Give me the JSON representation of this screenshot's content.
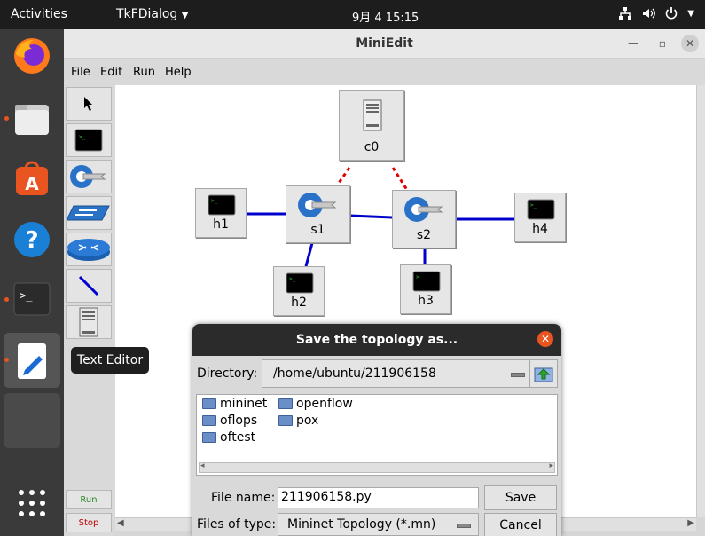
{
  "topbar": {
    "activities": "Activities",
    "app_name": "TkFDialog",
    "clock": "9月 4  15:15"
  },
  "dock": {
    "tooltip": "Text Editor",
    "items": [
      "firefox-icon",
      "files-icon",
      "software-icon",
      "help-icon",
      "terminal-icon",
      "text-editor-icon",
      "workspace-icon"
    ]
  },
  "window": {
    "title": "MiniEdit",
    "menu": [
      "File",
      "Edit",
      "Run",
      "Help"
    ],
    "toolbar": {
      "run": "Run",
      "stop": "Stop"
    }
  },
  "canvas": {
    "nodes": {
      "c0": "c0",
      "h1": "h1",
      "s1": "s1",
      "s2": "s2",
      "h4": "h4",
      "h2": "h2",
      "h3": "h3"
    }
  },
  "dialog": {
    "title": "Save the topology as...",
    "directory_label": "Directory:",
    "directory_value": "/home/ubuntu/211906158",
    "files": [
      "mininet",
      "openflow",
      "oflops",
      "pox",
      "oftest"
    ],
    "filename_label": "File name:",
    "filename_value": "211906158.py",
    "save_label": "Save",
    "filetype_label": "Files of type:",
    "filetype_value": "Mininet Topology (*.mn)",
    "cancel_label": "Cancel"
  },
  "colors": {
    "accent": "#e95420",
    "link": "#0000cc",
    "control_link": "#e00000"
  }
}
